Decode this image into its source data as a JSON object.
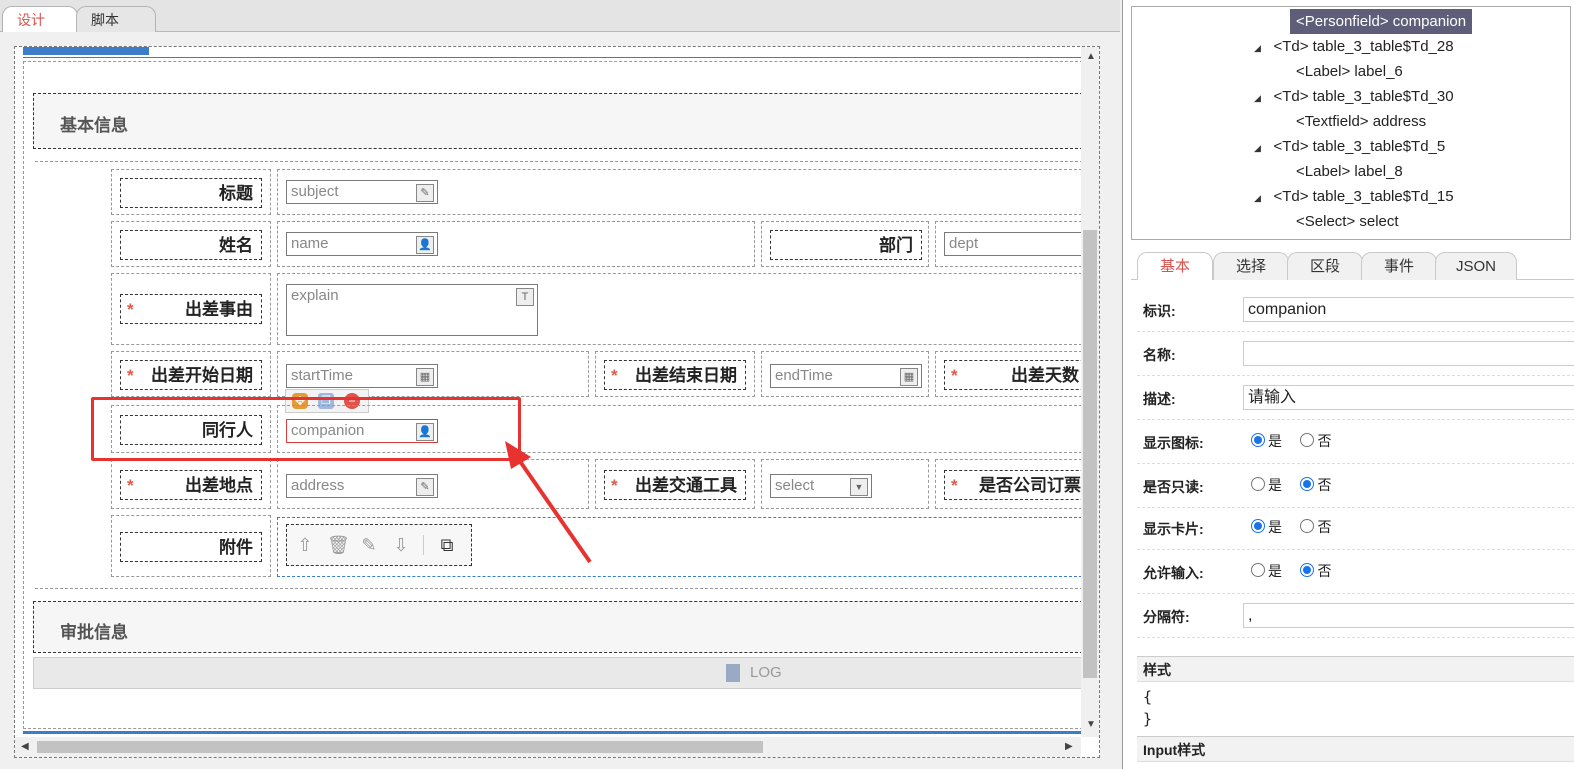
{
  "top_tabs": {
    "design": "设计",
    "script": "脚本"
  },
  "form": {
    "section_basic": "基本信息",
    "section_approval": "审批信息",
    "log_label": "LOG",
    "required_mark": "*",
    "fields": {
      "subject": {
        "label": "标题",
        "placeholder": "subject"
      },
      "name": {
        "label": "姓名",
        "placeholder": "name"
      },
      "dept": {
        "label": "部门",
        "placeholder": "dept"
      },
      "explain": {
        "label": "出差事由",
        "placeholder": "explain"
      },
      "start": {
        "label": "出差开始日期",
        "placeholder": "startTime"
      },
      "end": {
        "label": "出差结束日期",
        "placeholder": "endTime"
      },
      "days": {
        "label": "出差天数"
      },
      "companion": {
        "label": "同行人",
        "placeholder": "companion"
      },
      "address": {
        "label": "出差地点",
        "placeholder": "address"
      },
      "transport": {
        "label": "出差交通工具",
        "placeholder": "select"
      },
      "booking": {
        "label": "是否公司订票"
      },
      "attachment": {
        "label": "附件"
      }
    }
  },
  "tree": {
    "nodes": [
      {
        "text": "<Personfield> companion",
        "selected": true
      },
      {
        "text": "<Td> table_3_table$Td_28"
      },
      {
        "text": "<Label> label_6"
      },
      {
        "text": "<Td> table_3_table$Td_30"
      },
      {
        "text": "<Textfield> address"
      },
      {
        "text": "<Td> table_3_table$Td_5"
      },
      {
        "text": "<Label> label_8"
      },
      {
        "text": "<Td> table_3_table$Td_15"
      },
      {
        "text": "<Select> select"
      }
    ]
  },
  "prop_tabs": [
    "基本",
    "选择",
    "区段",
    "事件",
    "JSON"
  ],
  "props": {
    "id_label": "标识:",
    "id_value": "companion",
    "name_label": "名称:",
    "name_value": "",
    "desc_label": "描述:",
    "desc_value": "请输入",
    "show_icon_label": "显示图标:",
    "readonly_label": "是否只读:",
    "show_card_label": "显示卡片:",
    "allow_input_label": "允许输入:",
    "separator_label": "分隔符:",
    "separator_value": ",",
    "yes": "是",
    "no": "否",
    "style_head": "样式",
    "style_line1": "{",
    "style_line2": "}",
    "input_style_head": "Input样式"
  }
}
